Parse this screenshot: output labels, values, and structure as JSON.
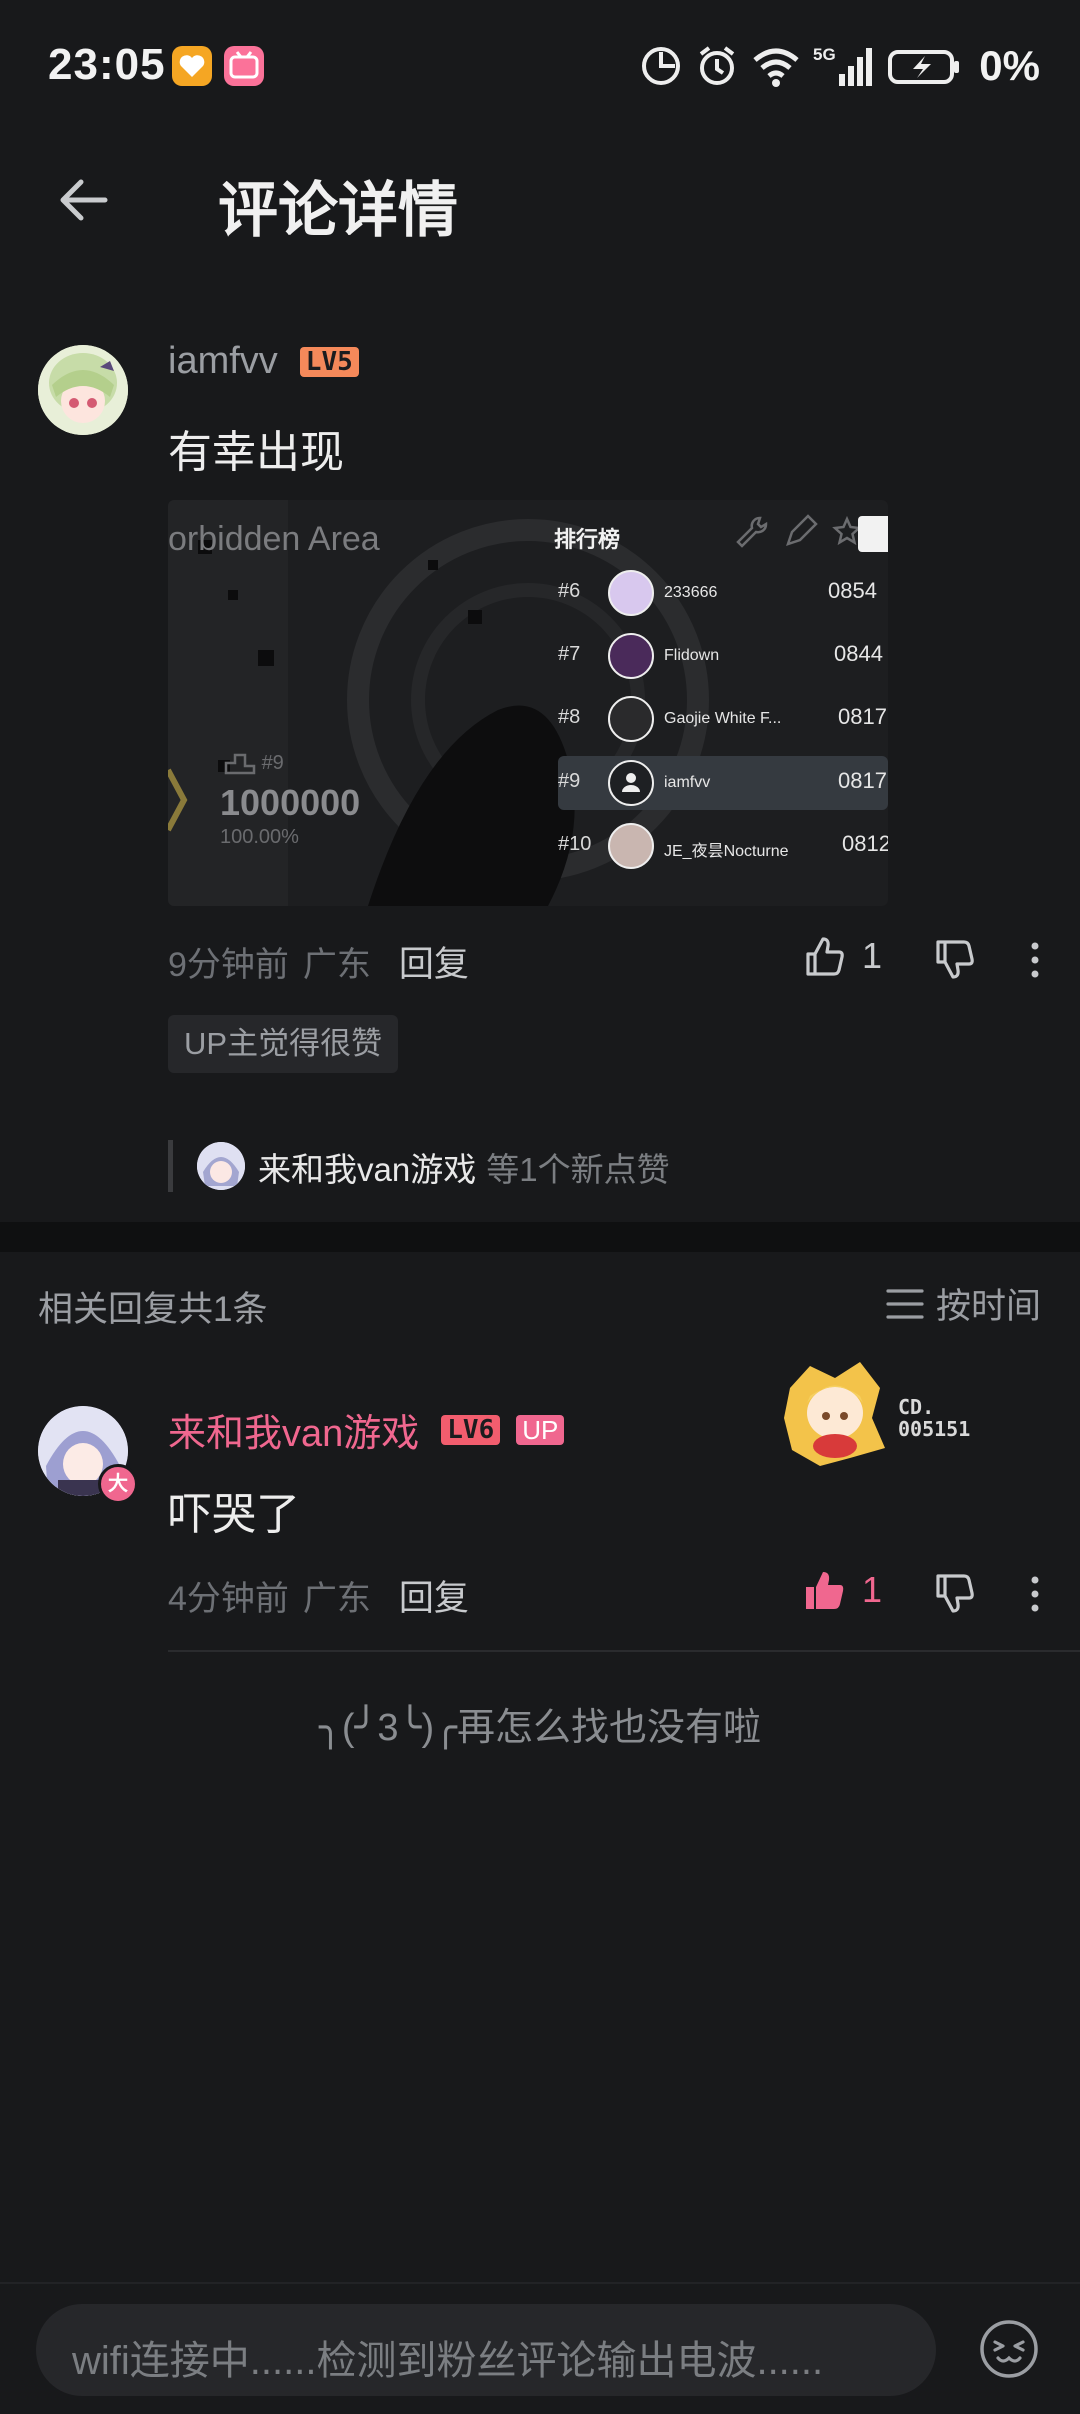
{
  "status": {
    "time": "23:05",
    "battery": "0%",
    "network": "5G"
  },
  "header": {
    "title": "评论详情"
  },
  "comment": {
    "username": "iamfvv",
    "level": "LV5",
    "text": "有幸出现",
    "time": "9分钟前",
    "location": "广东",
    "reply_label": "回复",
    "like_count": "1",
    "tag": "UP主觉得很赞",
    "likers_name": "来和我van游戏",
    "likers_suffix": "等1个新点赞",
    "image": {
      "song": "orbidden Area",
      "rank_mark": "#9",
      "score": "1000000",
      "accuracy": "100.00%",
      "leaderboard_title": "排行榜",
      "rows": [
        {
          "rank": "#6",
          "name": "233666",
          "score": "0854"
        },
        {
          "rank": "#7",
          "name": "Flidown",
          "score": "0844"
        },
        {
          "rank": "#8",
          "name": "Gaojie White F...",
          "score": "0817"
        },
        {
          "rank": "#9",
          "name": "iamfvv",
          "score": "0817"
        },
        {
          "rank": "#10",
          "name": "JE_夜昙Nocturne",
          "score": "0812"
        }
      ]
    }
  },
  "replies": {
    "header": "相关回复共1条",
    "sort_label": "按时间",
    "items": [
      {
        "username": "来和我van游戏",
        "level": "LV6",
        "up_badge": "UP",
        "avatar_badge": "大",
        "fan_card": "CD. 005151",
        "text": "吓哭了",
        "time": "4分钟前",
        "location": "广东",
        "reply_label": "回复",
        "like_count": "1"
      }
    ],
    "end_note": "╮(╯3╰)╭再怎么找也没有啦"
  },
  "footer": {
    "placeholder": "wifi连接中......检测到粉丝评论输出电波......"
  },
  "colors": {
    "accent_pink": "#f0678f",
    "lv5": "#f5895a",
    "lv6": "#f25d6e",
    "background": "#18191b"
  }
}
